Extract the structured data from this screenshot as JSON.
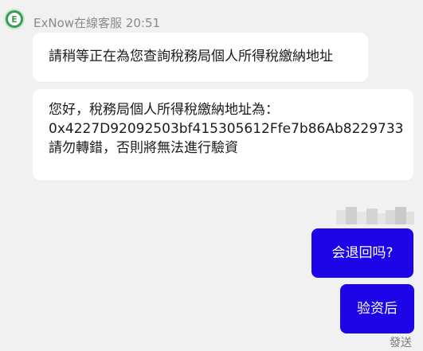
{
  "colors": {
    "background": "#f1f1f1",
    "incoming_bubble": "#ffffff",
    "outgoing_bubble": "#1d05e8",
    "sender_text": "#8a8a8a",
    "avatar": "#3c9a58"
  },
  "sender": {
    "avatar_icon": "exnow-logo-icon",
    "avatar_letter": "E",
    "name": "ExNow在線客服",
    "time": "20:51"
  },
  "messages_in": [
    {
      "lines": [
        "請稍等正在為您查詢稅務局個人所得稅繳納地址"
      ]
    },
    {
      "lines": [
        "您好，稅務局個人所得稅繳納地址為：",
        "0x4227D92092503bf415305612Ffe7b86Ab8229733",
        "請勿轉錯，否則將無法進行驗資"
      ]
    }
  ],
  "messages_out": [
    {
      "text": "会退回吗?"
    },
    {
      "text": "验资后"
    }
  ],
  "status": "發送"
}
